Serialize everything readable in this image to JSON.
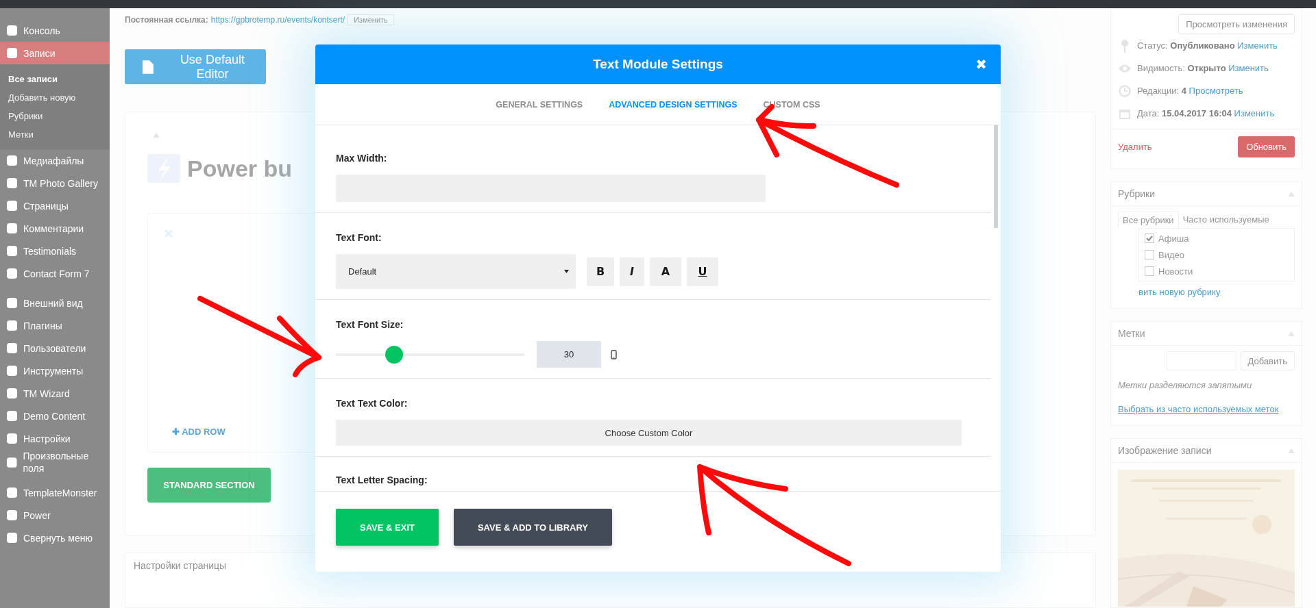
{
  "sidebar": {
    "groups": [
      {
        "items": [
          {
            "label": "Консоль",
            "selected": false
          },
          {
            "label": "Записи",
            "selected": true,
            "children": [
              {
                "label": "Все записи",
                "selected": true
              },
              {
                "label": "Добавить новую",
                "selected": false
              },
              {
                "label": "Рубрики",
                "selected": false
              },
              {
                "label": "Метки",
                "selected": false
              }
            ]
          },
          {
            "label": "Медиафайлы",
            "selected": false
          },
          {
            "label": "TM Photo Gallery",
            "selected": false
          },
          {
            "label": "Страницы",
            "selected": false
          },
          {
            "label": "Комментарии",
            "selected": false
          },
          {
            "label": "Testimonials",
            "selected": false
          },
          {
            "label": "Contact Form 7",
            "selected": false
          }
        ]
      },
      {
        "items": [
          {
            "label": "Внешний вид",
            "selected": false
          },
          {
            "label": "Плагины",
            "selected": false
          },
          {
            "label": "Пользователи",
            "selected": false
          },
          {
            "label": "Инструменты",
            "selected": false
          },
          {
            "label": "TM Wizard",
            "selected": false
          },
          {
            "label": "Demo Content",
            "selected": false
          },
          {
            "label": "Настройки",
            "selected": false
          },
          {
            "label": "Произвольные поля",
            "selected": false
          }
        ]
      },
      {
        "items": [
          {
            "label": "TemplateMonster",
            "selected": false
          },
          {
            "label": "Power",
            "selected": false
          },
          {
            "label": "Свернуть меню",
            "selected": false
          }
        ]
      }
    ]
  },
  "permalink": {
    "label": "Постоянная ссылка:",
    "url": "https://gpbrotemp.ru/events/kontsert/",
    "button": "Изменить"
  },
  "editor_button": "Use Default Editor",
  "builder": {
    "title": "Power bu",
    "add_row": "ADD ROW",
    "add_row_icon": "✚",
    "section_button": "STANDARD SECTION"
  },
  "page_settings": {
    "title": "Настройки страницы"
  },
  "publish": {
    "preview_button": "Просмотреть изменения",
    "rows": [
      {
        "label": "Статус:",
        "value": "Опубликовано",
        "link": "Изменить"
      },
      {
        "label": "Видимость:",
        "value": "Открыто",
        "link": "Изменить"
      },
      {
        "label": "Редакции:",
        "value": "4",
        "link": "Просмотреть"
      },
      {
        "label": "Дата:",
        "value": "15.04.2017 16:04",
        "link": "Изменить"
      }
    ],
    "delete_link": "Удалить",
    "update_button": "Обновить"
  },
  "categories": {
    "title": "Рубрики",
    "tabs": [
      {
        "label": "Все рубрики",
        "selected": true
      },
      {
        "label": "Часто используемые",
        "selected": false
      }
    ],
    "items": [
      {
        "label": "Афиша",
        "checked": true
      },
      {
        "label": "Видео",
        "checked": false
      },
      {
        "label": "Новости",
        "checked": false
      }
    ],
    "add_link": "вить новую рубрику"
  },
  "tags": {
    "title": "Метки",
    "add_button": "Добавить",
    "hint": "Метки разделяются запятыми",
    "choose_link": "Выбрать из часто используемых меток"
  },
  "featured_image": {
    "title": "Изображение записи"
  },
  "modal": {
    "title": "Text Module Settings",
    "close": "✖",
    "tabs": [
      {
        "label": "GENERAL SETTINGS",
        "selected": false
      },
      {
        "label": "ADVANCED DESIGN SETTINGS",
        "selected": true
      },
      {
        "label": "CUSTOM CSS",
        "selected": false
      }
    ],
    "fields": [
      {
        "kind": "text",
        "label": "Max Width:"
      },
      {
        "kind": "font",
        "label": "Text Font:",
        "value": "Default",
        "styles": [
          {
            "label": "B",
            "kind": "bold"
          },
          {
            "label": "I",
            "kind": "italic"
          },
          {
            "label": "A",
            "kind": "plain"
          },
          {
            "label": "U",
            "kind": "underline"
          }
        ]
      },
      {
        "kind": "slider",
        "label": "Text Font Size:",
        "level": 0.31,
        "value": "30"
      },
      {
        "kind": "color",
        "label": "Text Text Color:",
        "button": "Choose Custom Color"
      },
      {
        "kind": "heading",
        "label": "Text Letter Spacing:"
      }
    ],
    "buttons": [
      {
        "label": "SAVE & EXIT",
        "kind": "primary"
      },
      {
        "label": "SAVE & ADD TO LIBRARY",
        "kind": "secondary"
      }
    ]
  }
}
